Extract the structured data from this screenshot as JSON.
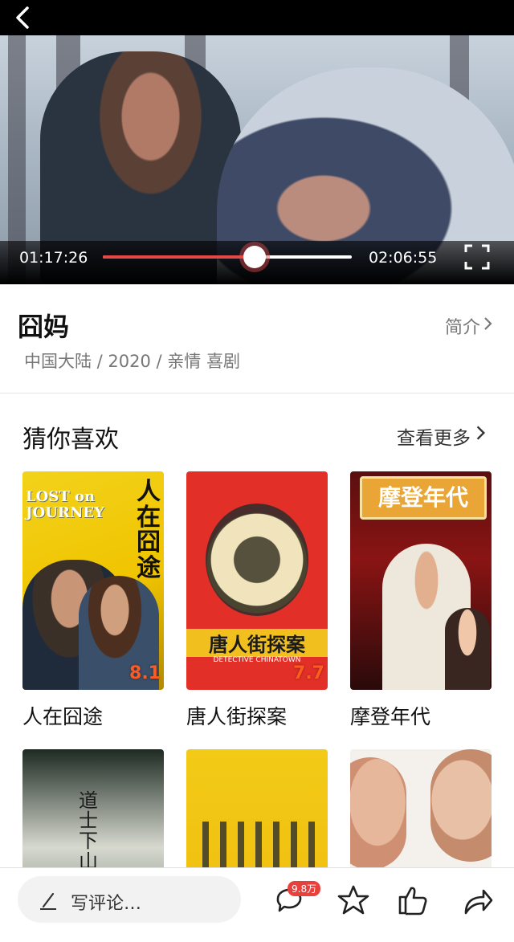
{
  "player": {
    "current_time": "01:17:26",
    "total_time": "02:06:55",
    "progress": 0.61
  },
  "movie": {
    "title": "囧妈",
    "intro_label": "简介",
    "meta": "中国大陆 / 2020 / 亲情 喜剧"
  },
  "recommend": {
    "section_title": "猜你喜欢",
    "more_label": "查看更多",
    "items": [
      {
        "title": "人在囧途",
        "score": "8.1"
      },
      {
        "title": "唐人街探案",
        "score": "7.7"
      },
      {
        "title": "摩登年代",
        "score": ""
      },
      {
        "title": "",
        "score": ""
      },
      {
        "title": "",
        "score": ""
      },
      {
        "title": "",
        "score": ""
      }
    ],
    "poster_texts": {
      "p0_en": "LOST on JOURNEY",
      "p0_cn": "人在囧途",
      "p1_cn": "唐人街探案",
      "p1_en": "DETECTIVE CHINATOWN",
      "p2_cn": "摩登年代",
      "p3_cn": "道士下山"
    }
  },
  "bottom": {
    "comment_placeholder": "写评论…",
    "comment_count": "9.8万"
  },
  "icons": [
    "back-icon",
    "fullscreen-icon",
    "chevron-right-icon",
    "pen-icon",
    "comment-icon",
    "star-icon",
    "thumbs-up-icon",
    "share-icon"
  ],
  "colors": {
    "accent": "#e24a4a",
    "badge": "#e8413c",
    "score": "#ff5a1f"
  }
}
